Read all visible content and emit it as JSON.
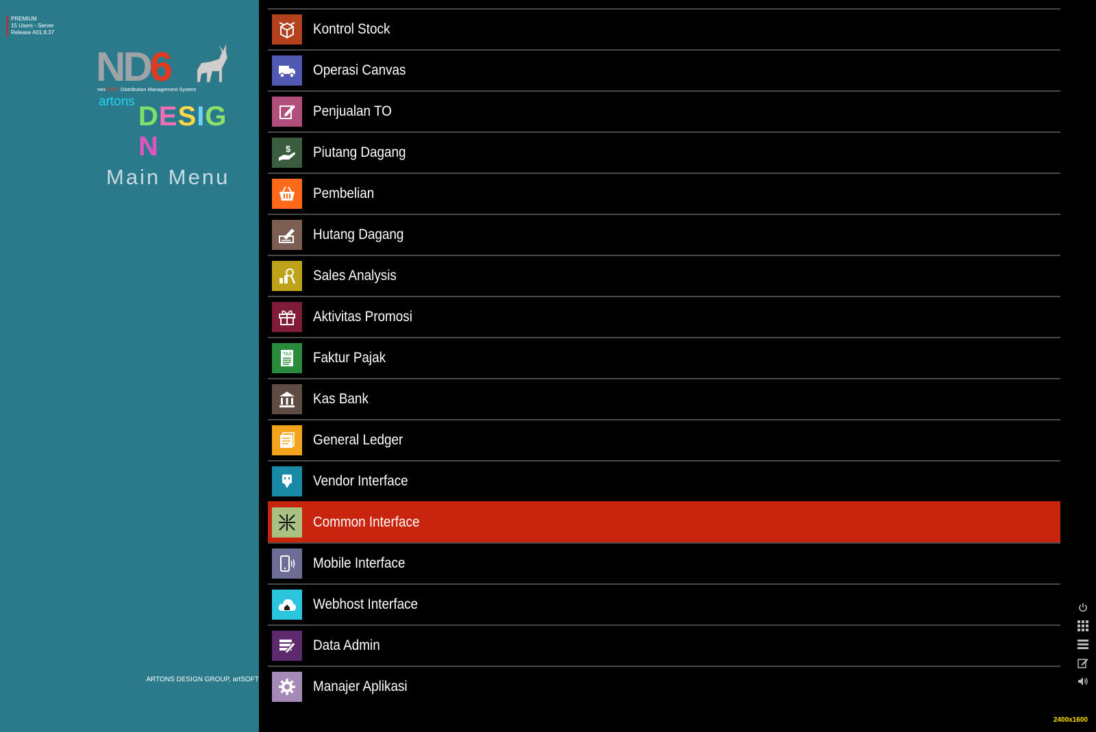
{
  "license": {
    "edition": "PREMIUM",
    "users": "15 Users - Server",
    "release": "Release A01.8.37"
  },
  "logo": {
    "nd": "ND",
    "six": "6",
    "nexsoft_prefix": "nex",
    "nexsoft_mid": "SOFT",
    "tagline": " Distribution Management System",
    "artons": "artons",
    "design": "DESIGN"
  },
  "sidebar": {
    "title": "Main Menu",
    "footer": "ARTONS DESIGN GROUP, artSOFT"
  },
  "menu": {
    "items": [
      {
        "label": "Kontrol Stock",
        "icon": "box-icon",
        "color": "#b3411d"
      },
      {
        "label": "Operasi Canvas",
        "icon": "truck-icon",
        "color": "#5259b3"
      },
      {
        "label": "Penjualan TO",
        "icon": "edit-icon",
        "color": "#b04f7c"
      },
      {
        "label": "Piutang Dagang",
        "icon": "hand-money-icon",
        "color": "#3b5d3f"
      },
      {
        "label": "Pembelian",
        "icon": "basket-icon",
        "color": "#ff6a1a"
      },
      {
        "label": "Hutang Dagang",
        "icon": "signature-icon",
        "color": "#7d5e53"
      },
      {
        "label": "Sales Analysis",
        "icon": "analysis-icon",
        "color": "#bda21a"
      },
      {
        "label": "Aktivitas Promosi",
        "icon": "gift-icon",
        "color": "#801c3a"
      },
      {
        "label": "Faktur Pajak",
        "icon": "tax-icon",
        "color": "#2a8a3c"
      },
      {
        "label": "Kas Bank",
        "icon": "bank-icon",
        "color": "#5e4b43"
      },
      {
        "label": "General Ledger",
        "icon": "ledger-icon",
        "color": "#f3a31c"
      },
      {
        "label": "Vendor Interface",
        "icon": "plug-icon",
        "color": "#1a89a5"
      },
      {
        "label": "Common Interface",
        "icon": "arrows-in-icon",
        "color": "#a9c283"
      },
      {
        "label": "Mobile Interface",
        "icon": "mobile-icon",
        "color": "#6d6d95"
      },
      {
        "label": "Webhost Interface",
        "icon": "cloud-home-icon",
        "color": "#2bc6dd"
      },
      {
        "label": "Data Admin",
        "icon": "data-admin-icon",
        "color": "#5d2a6e"
      },
      {
        "label": "Manajer Aplikasi",
        "icon": "gear-icon",
        "color": "#a589b6"
      }
    ],
    "active_index": 12,
    "active_color": "#c9240d"
  },
  "rightbar": [
    "power-icon",
    "grid-icon",
    "list-icon",
    "edit-icon",
    "volume-icon"
  ],
  "resolution": "2400x1600"
}
